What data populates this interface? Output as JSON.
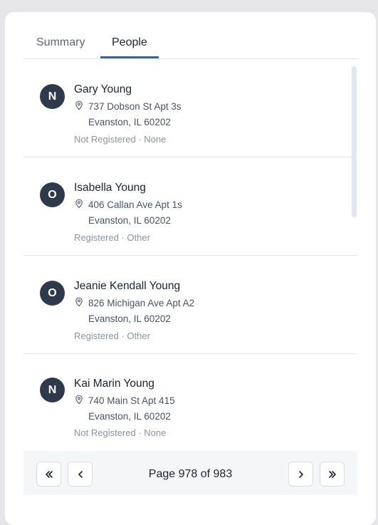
{
  "tabs": [
    {
      "label": "Summary",
      "active": false
    },
    {
      "label": "People",
      "active": true
    }
  ],
  "people": [
    {
      "initial": "N",
      "name": "Gary Young",
      "address_line1": "737 Dobson St Apt 3s",
      "address_line2": "Evanston, IL 60202",
      "status": "Not Registered · None"
    },
    {
      "initial": "O",
      "name": "Isabella Young",
      "address_line1": "406 Callan Ave Apt 1s",
      "address_line2": "Evanston, IL 60202",
      "status": "Registered · Other"
    },
    {
      "initial": "O",
      "name": "Jeanie Kendall Young",
      "address_line1": "826 Michigan Ave Apt A2",
      "address_line2": "Evanston, IL 60202",
      "status": "Registered · Other"
    },
    {
      "initial": "N",
      "name": "Kai Marin Young",
      "address_line1": "740 Main St Apt 415",
      "address_line2": "Evanston, IL 60202",
      "status": "Not Registered · None"
    }
  ],
  "pagination": {
    "label": "Page 978 of 983",
    "first_icon": "double-chevron-left-icon",
    "prev_icon": "chevron-left-icon",
    "next_icon": "chevron-right-icon",
    "last_icon": "double-chevron-right-icon"
  },
  "colors": {
    "avatar_bg": "#2e3a4b",
    "tab_active_underline": "#2a66b8",
    "card_bg": "#ffffff",
    "page_bg": "#e6e6e8"
  }
}
